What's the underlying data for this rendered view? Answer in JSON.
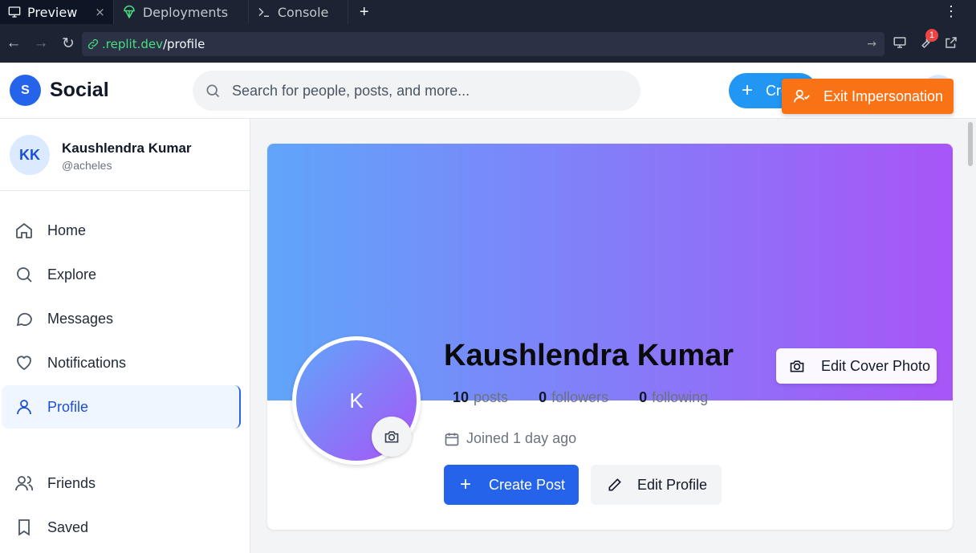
{
  "ide": {
    "tabs": [
      {
        "label": "Preview",
        "icon": "monitor-icon"
      },
      {
        "label": "Deployments",
        "icon": "deploy-icon"
      },
      {
        "label": "Console",
        "icon": "terminal-icon"
      }
    ],
    "close_glyph": "×",
    "new_tab_glyph": "+",
    "menu_glyph": "⋮"
  },
  "browser": {
    "url_host": ".replit.dev",
    "url_path": "/profile",
    "notification_count": "1"
  },
  "app": {
    "brand_letter": "S",
    "brand_name": "Social",
    "search_placeholder": "Search for people, posts, and more...",
    "create_label": "Create",
    "exit_impersonation_label": "Exit Impersonation"
  },
  "sidebar": {
    "user_initials": "KK",
    "user_name": "Kaushlendra Kumar",
    "user_handle": "@acheles",
    "items": [
      {
        "label": "Home",
        "icon": "home-icon"
      },
      {
        "label": "Explore",
        "icon": "search-icon"
      },
      {
        "label": "Messages",
        "icon": "message-icon"
      },
      {
        "label": "Notifications",
        "icon": "heart-icon"
      },
      {
        "label": "Profile",
        "icon": "user-icon",
        "active": true
      },
      {
        "label": "Friends",
        "icon": "users-icon"
      },
      {
        "label": "Saved",
        "icon": "bookmark-icon"
      }
    ]
  },
  "profile": {
    "initial": "K",
    "name": "Kaushlendra Kumar",
    "posts_count": "10",
    "posts_label": "posts",
    "followers_count": "0",
    "followers_label": "followers",
    "following_count": "0",
    "following_label": "following",
    "joined": "Joined 1 day ago",
    "edit_cover_label": "Edit Cover Photo",
    "create_post_label": "Create Post",
    "edit_profile_label": "Edit Profile"
  },
  "colors": {
    "accent": "#2563eb",
    "cover_start": "#60a5fa",
    "cover_end": "#a855f7",
    "impersonation": "#f97316"
  }
}
